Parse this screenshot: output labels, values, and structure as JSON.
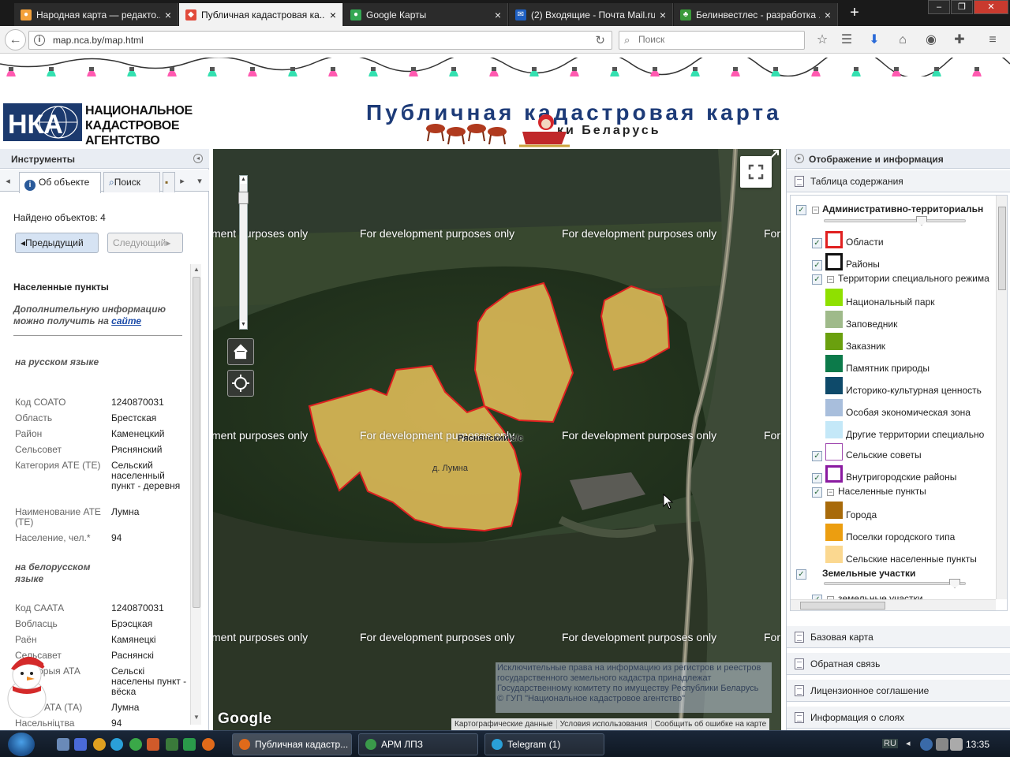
{
  "browser": {
    "tabs": [
      {
        "title": "Народная карта — редакто...",
        "icon_color": "#f3a13b"
      },
      {
        "title": "Публичная кадастровая ка...",
        "icon_color": "#e14a3b",
        "active": true
      },
      {
        "title": "Google Карты",
        "icon_color": "#34a853"
      },
      {
        "title": "(2) Входящие - Почта Mail.ru",
        "icon_color": "#1e5fc1"
      },
      {
        "title": "Белинвестлес - разработка ...",
        "icon_color": "#3a9a3a"
      }
    ],
    "url": "map.nca.by/map.html",
    "search_placeholder": "Поиск"
  },
  "header": {
    "logo_lines": [
      "НАЦИОНАЛЬНОЕ",
      "КАДАСТРОВОЕ",
      "АГЕНТСТВО"
    ],
    "title": "Публичная кадастровая карта",
    "subtitle": "ки Беларусь"
  },
  "left_panel": {
    "title": "Инструменты",
    "tabs": [
      "Об объекте",
      "Поиск"
    ],
    "found": "Найдено объектов: 4",
    "prev_label": "◂Предыдущий",
    "next_label": "Следующий▸",
    "section_title": "Населенные пункты",
    "note_text": "Дополнительную информацию можно получить на",
    "note_link": "сайте",
    "russian_heading": "на русском языке",
    "russian_fields": [
      {
        "k": "Код СОАТО",
        "v": "1240870031"
      },
      {
        "k": "Область",
        "v": "Брестская"
      },
      {
        "k": "Район",
        "v": "Каменецкий"
      },
      {
        "k": "Сельсовет",
        "v": "Ряснянский"
      },
      {
        "k": "Категория АТЕ (ТЕ)",
        "v": "Сельский населенный пункт - деревня"
      },
      {
        "k": "Наименование АТЕ (ТЕ)",
        "v": "Лумна"
      },
      {
        "k": "Население, чел.*",
        "v": "94"
      }
    ],
    "belarusian_heading": "на белорусском языке",
    "belarusian_fields": [
      {
        "k": "Код СААТА",
        "v": "1240870031"
      },
      {
        "k": "Вобласць",
        "v": "Брэсцкая"
      },
      {
        "k": "Раён",
        "v": "Камянецкі"
      },
      {
        "k": "Сельсавет",
        "v": "Раснянскі"
      },
      {
        "k": "Катэгорыя АТА",
        "v": "Сельскі населены пункт - вёска"
      },
      {
        "k": "Назва АТА (ТА)",
        "v": "Лумна"
      },
      {
        "k": "Насельніцтва",
        "v": "94"
      }
    ]
  },
  "map": {
    "watermark": "For development purposes only",
    "watermark_cut_left": "ment purposes only",
    "watermark_cut_right": "For",
    "label_selsovet": "Ряснянский с/с",
    "label_village": "д. Лумна",
    "copyright": "Исключительные права на информацию из регистров и реестров государственного земельного кадастра принадлежат Государственному комитету по имуществу Республики Беларусь\n© ГУП \"Национальное кадастровое агентство\"",
    "google": "Google",
    "attribution": [
      "Картографические данные",
      "Условия использования",
      "Сообщить об ошибке на карте"
    ],
    "polygon_fill": "#e8c25a",
    "polygon_stroke": "#e02020"
  },
  "right_panel": {
    "title": "Отображение и информация",
    "toc_title": "Таблица содержания",
    "layers": {
      "admin": "Административно-территориальн",
      "oblasti": "Области",
      "rayony": "Районы",
      "special": "Территории специального режима",
      "np": "Национальный парк",
      "zapoved": "Заповедник",
      "zakaz": "Заказник",
      "pamyat": "Памятник природы",
      "istor": "Историко-культурная ценность",
      "oez": "Особая экономическая зона",
      "drugie": "Другие территории специально",
      "selsovety": "Сельские советы",
      "vnutrigor": "Внутригородские районы",
      "nasel": "Населенные пункты",
      "goroda": "Города",
      "poselki": "Поселки городского типа",
      "selskie": "Сельские населенные пункты",
      "zemuch": "Земельные участки",
      "zemuch2": "земельные участки"
    },
    "swatch_colors": {
      "np": "#8fe000",
      "zapoved": "#9fba8a",
      "zakaz": "#6aa00e",
      "pamyat": "#0c7a4a",
      "istor": "#0e4a6a",
      "oez": "#a8bedc",
      "drugie": "#c4e8f8",
      "goroda": "#a86a0a",
      "poselki": "#ec9e10",
      "selskie": "#fbd890"
    },
    "sections": [
      "Базовая карта",
      "Обратная связь",
      "Лицензионное соглашение",
      "Информация о слоях"
    ]
  },
  "taskbar": {
    "tasks": [
      "Публичная кадастр...",
      "АРМ ЛПЗ",
      "Telegram (1)"
    ],
    "lang": "RU",
    "time": "13:35"
  }
}
